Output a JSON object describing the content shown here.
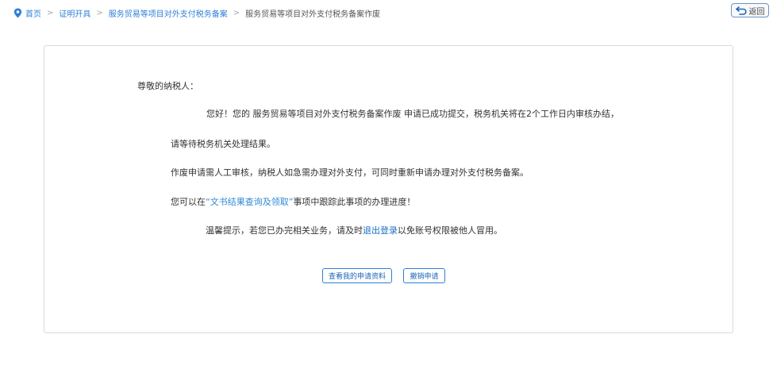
{
  "breadcrumb": {
    "home": "首页",
    "item2": "证明开具",
    "item3": "服务贸易等项目对外支付税务备案",
    "current": "服务贸易等项目对外支付税务备案作废",
    "separator": ">"
  },
  "back_button": {
    "label": "返回"
  },
  "notice": {
    "greeting": "尊敬的纳税人：",
    "p1_prefix": "您好！您的 ",
    "p1_item": "服务贸易等项目对外支付税务备案作废",
    "p1_suffix": " 申请已成功提交，税务机关将在2个工作日内审核办结，",
    "p1_cont": "请等待税务机关处理结果。",
    "p2": "作废申请需人工审核，纳税人如急需办理对外支付，可同时重新申请办理对外支付税务备案。",
    "p3_prefix": "您可以在",
    "p3_link": "“文书结果查询及领取”",
    "p3_suffix": "事项中跟踪此事项的办理进度！",
    "p4_prefix": "温馨提示，若您已办完相关业务，请及时",
    "p4_link": "退出登录",
    "p4_suffix": "以免账号权限被他人冒用。"
  },
  "actions": {
    "view_label": "查看我的申请资料",
    "cancel_label": "撤销申请"
  },
  "colors": {
    "link": "#2f7fd8",
    "border": "#d9d9d9"
  },
  "icons": {
    "home": "location-pin-icon",
    "back": "return-arrow-icon"
  }
}
